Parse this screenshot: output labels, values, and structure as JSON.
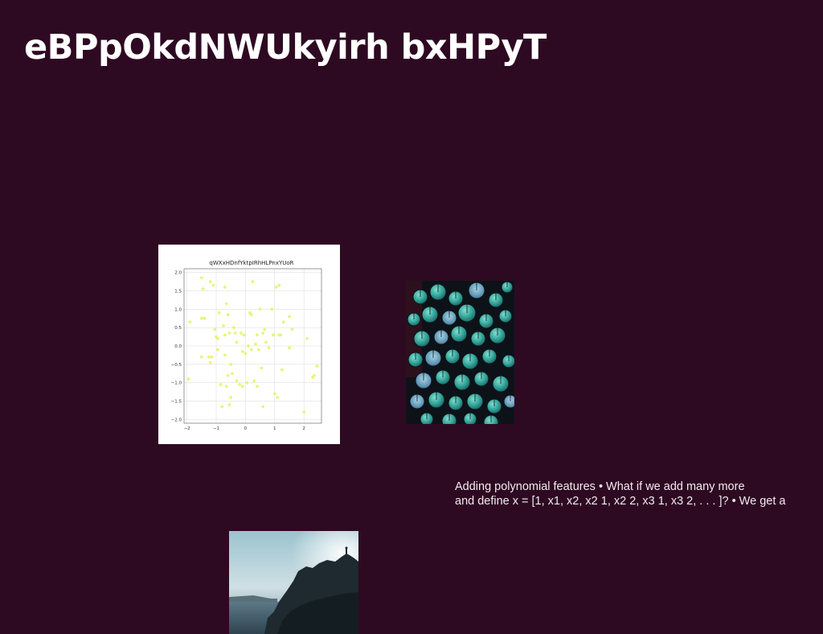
{
  "slide": {
    "title": "eBPpOkdNWUkyirh bxHPyT",
    "background_color": "#2e0a22",
    "body_lines": [
      "Adding polynomial features • What if we add many more",
      "and define x = [1, x1, x2, x2 1, x2 2, x3 1, x3 2, . . . ]? • We get a"
    ]
  },
  "images": {
    "leaves_photo": {
      "subject": "teal round leaves on dark background"
    },
    "coast_photo": {
      "subject": "rocky headland silhouette over water at dusk"
    }
  },
  "chart_data": {
    "type": "scatter",
    "title": "qWXxHDnfYktpIRhHLPnxYUoR",
    "xlabel": "",
    "ylabel": "",
    "xlim": [
      -2.1,
      2.6
    ],
    "ylim": [
      -2.1,
      2.1
    ],
    "x_ticks": [
      "−2",
      "−1",
      "0",
      "1",
      "2"
    ],
    "x_tick_values": [
      -2,
      -1,
      0,
      1,
      2
    ],
    "y_ticks": [
      "2.0",
      "1.5",
      "1.0",
      "0.5",
      "0.0",
      "−0.5",
      "−1.0",
      "−1.5",
      "−2.0"
    ],
    "y_tick_values": [
      2.0,
      1.5,
      1.0,
      0.5,
      0.0,
      -0.5,
      -1.0,
      -1.5,
      -2.0
    ],
    "grid": true,
    "marker_color": "#e8f57a",
    "points": [
      [
        -1.9,
        0.65
      ],
      [
        -1.95,
        -0.9
      ],
      [
        -1.5,
        1.85
      ],
      [
        -1.45,
        1.55
      ],
      [
        -1.5,
        0.75
      ],
      [
        -1.4,
        0.75
      ],
      [
        -1.5,
        -0.3
      ],
      [
        -1.2,
        1.75
      ],
      [
        -1.1,
        1.65
      ],
      [
        -1.25,
        -0.3
      ],
      [
        -1.15,
        -0.3
      ],
      [
        -1.2,
        -0.45
      ],
      [
        -1.05,
        0.45
      ],
      [
        -1.0,
        0.25
      ],
      [
        -0.95,
        0.2
      ],
      [
        -0.9,
        0.9
      ],
      [
        -0.95,
        -0.1
      ],
      [
        -0.85,
        -1.05
      ],
      [
        -0.8,
        -1.65
      ],
      [
        -0.75,
        0.55
      ],
      [
        -0.7,
        1.6
      ],
      [
        -0.65,
        1.15
      ],
      [
        -0.6,
        0.85
      ],
      [
        -0.7,
        0.3
      ],
      [
        -0.7,
        -0.25
      ],
      [
        -0.6,
        -0.8
      ],
      [
        -0.65,
        -1.1
      ],
      [
        -0.55,
        -1.6
      ],
      [
        -0.5,
        -1.4
      ],
      [
        -0.55,
        0.35
      ],
      [
        -0.5,
        -0.5
      ],
      [
        -0.45,
        -0.75
      ],
      [
        -0.4,
        0.5
      ],
      [
        -0.35,
        0.35
      ],
      [
        -0.3,
        -0.95
      ],
      [
        -0.3,
        0.1
      ],
      [
        -0.2,
        -1.05
      ],
      [
        -0.15,
        0.35
      ],
      [
        -0.1,
        -0.15
      ],
      [
        -0.1,
        -1.1
      ],
      [
        -0.05,
        0.3
      ],
      [
        0.0,
        -0.2
      ],
      [
        0.05,
        -1.0
      ],
      [
        0.1,
        0.0
      ],
      [
        0.15,
        0.9
      ],
      [
        0.2,
        0.85
      ],
      [
        0.2,
        -0.1
      ],
      [
        0.25,
        1.75
      ],
      [
        0.3,
        -0.95
      ],
      [
        0.35,
        0.05
      ],
      [
        0.4,
        -1.1
      ],
      [
        0.4,
        0.3
      ],
      [
        0.45,
        -0.1
      ],
      [
        0.5,
        1.0
      ],
      [
        0.55,
        -0.6
      ],
      [
        0.6,
        -1.65
      ],
      [
        0.6,
        0.35
      ],
      [
        0.65,
        0.45
      ],
      [
        0.7,
        0.1
      ],
      [
        0.8,
        -0.05
      ],
      [
        0.9,
        1.0
      ],
      [
        0.95,
        0.3
      ],
      [
        1.0,
        -1.3
      ],
      [
        1.05,
        1.6
      ],
      [
        1.1,
        -1.4
      ],
      [
        1.15,
        1.65
      ],
      [
        1.15,
        0.3
      ],
      [
        1.2,
        0.3
      ],
      [
        1.25,
        -0.65
      ],
      [
        1.3,
        0.65
      ],
      [
        1.5,
        0.8
      ],
      [
        1.5,
        -0.05
      ],
      [
        1.6,
        0.45
      ],
      [
        2.0,
        -1.8
      ],
      [
        2.1,
        0.2
      ],
      [
        2.3,
        -0.85
      ],
      [
        2.35,
        -0.8
      ],
      [
        2.45,
        -0.55
      ]
    ]
  }
}
